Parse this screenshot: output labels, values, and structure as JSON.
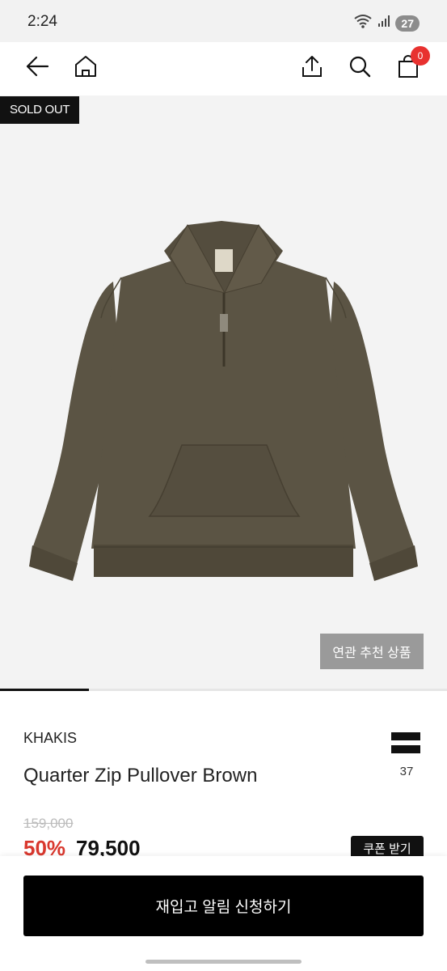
{
  "status_bar": {
    "time": "2:24",
    "battery": "27"
  },
  "cart": {
    "count": "0"
  },
  "product": {
    "badge": "SOLD OUT",
    "related_label": "연관 추천 상품",
    "brand": "KHAKIS",
    "name": "Quarter Zip Pullover Brown",
    "likes": "37",
    "original_price": "159,000",
    "discount": "50%",
    "price": "79,500",
    "coupon_label": "쿠폰 받기"
  },
  "cta": {
    "label": "재입고 알림 신청하기"
  },
  "colors": {
    "accent_red": "#e8312f",
    "price_red": "#d9382e",
    "garment_brown": "#5b5444"
  },
  "icons": [
    "back-arrow-icon",
    "home-icon",
    "share-icon",
    "search-icon",
    "shopping-bag-icon",
    "wifi-icon",
    "signal-icon"
  ]
}
